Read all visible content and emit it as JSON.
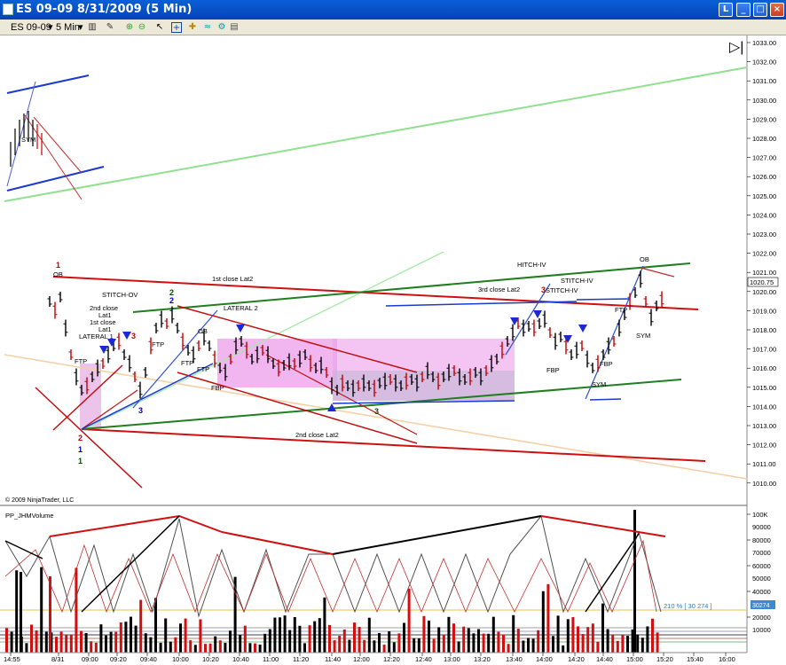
{
  "window": {
    "title": "ES 09-09  8/31/2009 (5 Min)",
    "btn_extra": "L",
    "btn_min": "_",
    "btn_max": "□",
    "btn_close": "×"
  },
  "toolbar": {
    "instrument": "ES 09-09",
    "interval": "5 Min"
  },
  "price_axis": [
    "1033.00",
    "1032.00",
    "1031.00",
    "1030.00",
    "1029.00",
    "1028.00",
    "1027.00",
    "1026.00",
    "1025.00",
    "1024.00",
    "1023.00",
    "1022.00",
    "1021.00",
    "1020.00",
    "1019.00",
    "1018.00",
    "1017.00",
    "1016.00",
    "1015.00",
    "1014.00",
    "1013.00",
    "1012.00",
    "1011.00",
    "1010.00"
  ],
  "current_price": "1020.75",
  "indicator": {
    "name": "PP_JHMVolume",
    "axis": [
      "100K",
      "80000",
      "60000",
      "40000",
      "20000"
    ],
    "axis_extra": [
      "90000",
      "70000",
      "50000",
      "30000",
      "10000"
    ],
    "last_value": "30274",
    "pct_label": "210 % [ 30 274 ]"
  },
  "time_axis": [
    "8/31",
    "09:00",
    "09:20",
    "09:40",
    "10:00",
    "10:20",
    "10:40",
    "11:00",
    "11:20",
    "11:40",
    "12:00",
    "12:20",
    "12:40",
    "13:00",
    "13:20",
    "13:40",
    "14:00",
    "14:20",
    "14:40",
    "15:00",
    "15:20",
    "15:40",
    "16:00",
    "14:55"
  ],
  "copyright": "© 2009 NinjaTrader, LLC",
  "annotations": {
    "n1": "1",
    "ob1": "OB",
    "stitch": "STITCH-OV",
    "n2a": "2",
    "n2b": "2",
    "close2": "2nd close",
    "lat1": "Lat1",
    "close1": "1st close",
    "lat1b": "Lat1",
    "lateral1": "LATERAL 1",
    "n3a": "3",
    "ftp1": "FTP",
    "ftp2": "FTP",
    "ftp3": "FTP",
    "ftp4": "FTP",
    "ob2": "OB",
    "fbp1": "FBP",
    "c1lat2": "1st close Lat2",
    "lateral2": "LATERAL 2",
    "c2lat2": "2nd close Lat2",
    "n3b": "3",
    "n3c": "3",
    "n2c": "2",
    "n1b": "1",
    "n1c": "1",
    "c3lat2": "3rd close Lat2",
    "hitch": "HITCH-IV",
    "stitch2": "STITCH-IV",
    "stitch3": "STITCH-IV",
    "n3d": "3",
    "fbp2": "FBP",
    "fbp3": "FBP",
    "sym1": "SYM",
    "ftp5": "FTP",
    "ob3": "OB",
    "sym2": "SYM",
    "sym3": "SYM"
  }
}
